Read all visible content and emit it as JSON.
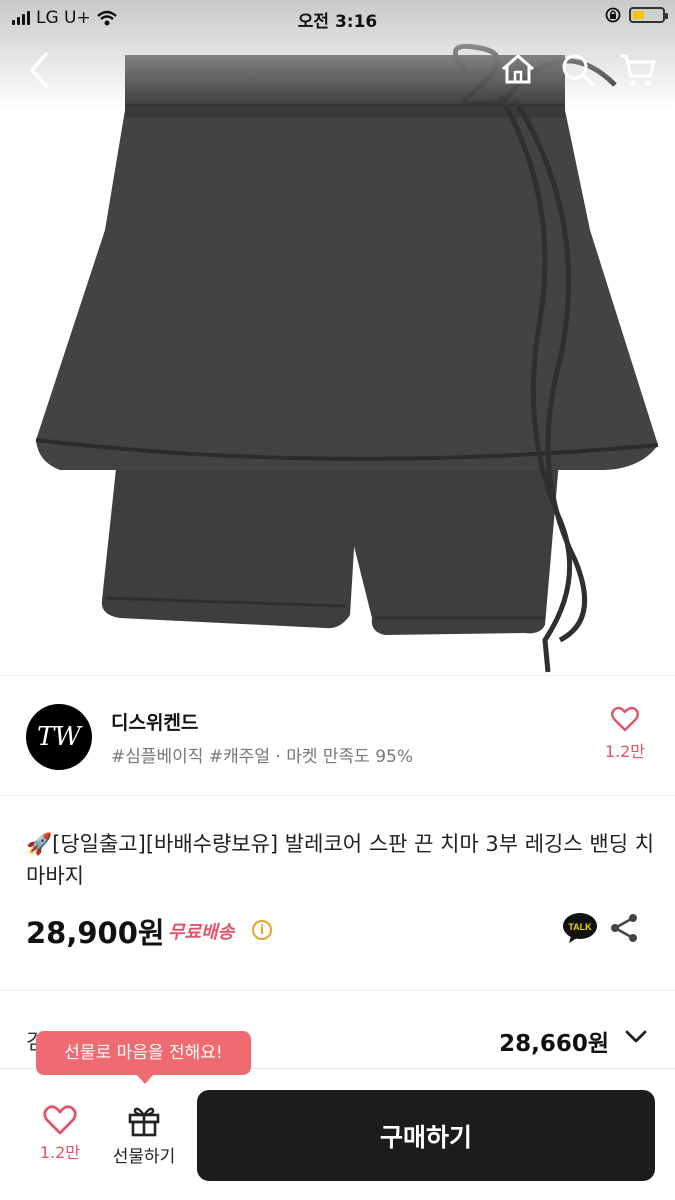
{
  "status_bar": {
    "carrier": "LG U+",
    "time": "오전 3:16"
  },
  "nav": {
    "icons": [
      "back-icon",
      "home-icon",
      "search-icon",
      "cart-icon"
    ]
  },
  "product_image": {
    "description_icon": "skirt-leggings-image"
  },
  "seller": {
    "logo_text": "TW",
    "name": "디스위켄드",
    "tags": "#심플베이직 #캐주얼 · 마켓 만족도 95%",
    "likes": "1.2만"
  },
  "product": {
    "title_emoji": "🚀",
    "title": "[당일출고][바배수량보유] 발레코어 스판 끈 치마 3부 레깅스 밴딩 치마바지",
    "price": "28,900원",
    "shipping": "무료배송",
    "talk_label": "TALK"
  },
  "discount": {
    "price": "28,660원"
  },
  "tooltip": {
    "text": "선물로 마음을 전해요!"
  },
  "bottom_bar": {
    "likes": "1.2만",
    "gift_label": "선물하기",
    "buy_label": "구매하기"
  },
  "colors": {
    "accent": "#e0556a",
    "tooltip": "#ef6b72",
    "buy_button": "#1c1c1c"
  }
}
